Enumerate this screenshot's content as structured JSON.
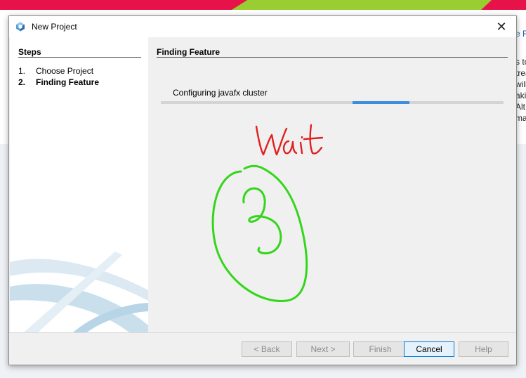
{
  "window": {
    "title": "New Project",
    "close_glyph": "✕"
  },
  "steps": {
    "heading": "Steps",
    "items": [
      {
        "num": "1.",
        "label": "Choose Project",
        "current": false
      },
      {
        "num": "2.",
        "label": "Finding Feature",
        "current": true
      }
    ]
  },
  "content": {
    "heading": "Finding Feature",
    "progress_label": "Configuring javafx cluster",
    "progress": {
      "indeterminate": true
    }
  },
  "annotation": {
    "text": "Wait",
    "number": "3",
    "text_color": "#e02020",
    "circle_color": "#33d61a"
  },
  "buttons": {
    "back": "< Back",
    "next": "Next >",
    "finish": "Finish",
    "cancel": "Cancel",
    "help": "Help"
  },
  "background_app": {
    "fragments": [
      "e F",
      "s to",
      "trea",
      "will",
      "aki",
      "Alt",
      "ma"
    ]
  },
  "colors": {
    "accent": "#3c8dde",
    "banner_red": "#e8124a",
    "banner_green": "#9acd32"
  }
}
